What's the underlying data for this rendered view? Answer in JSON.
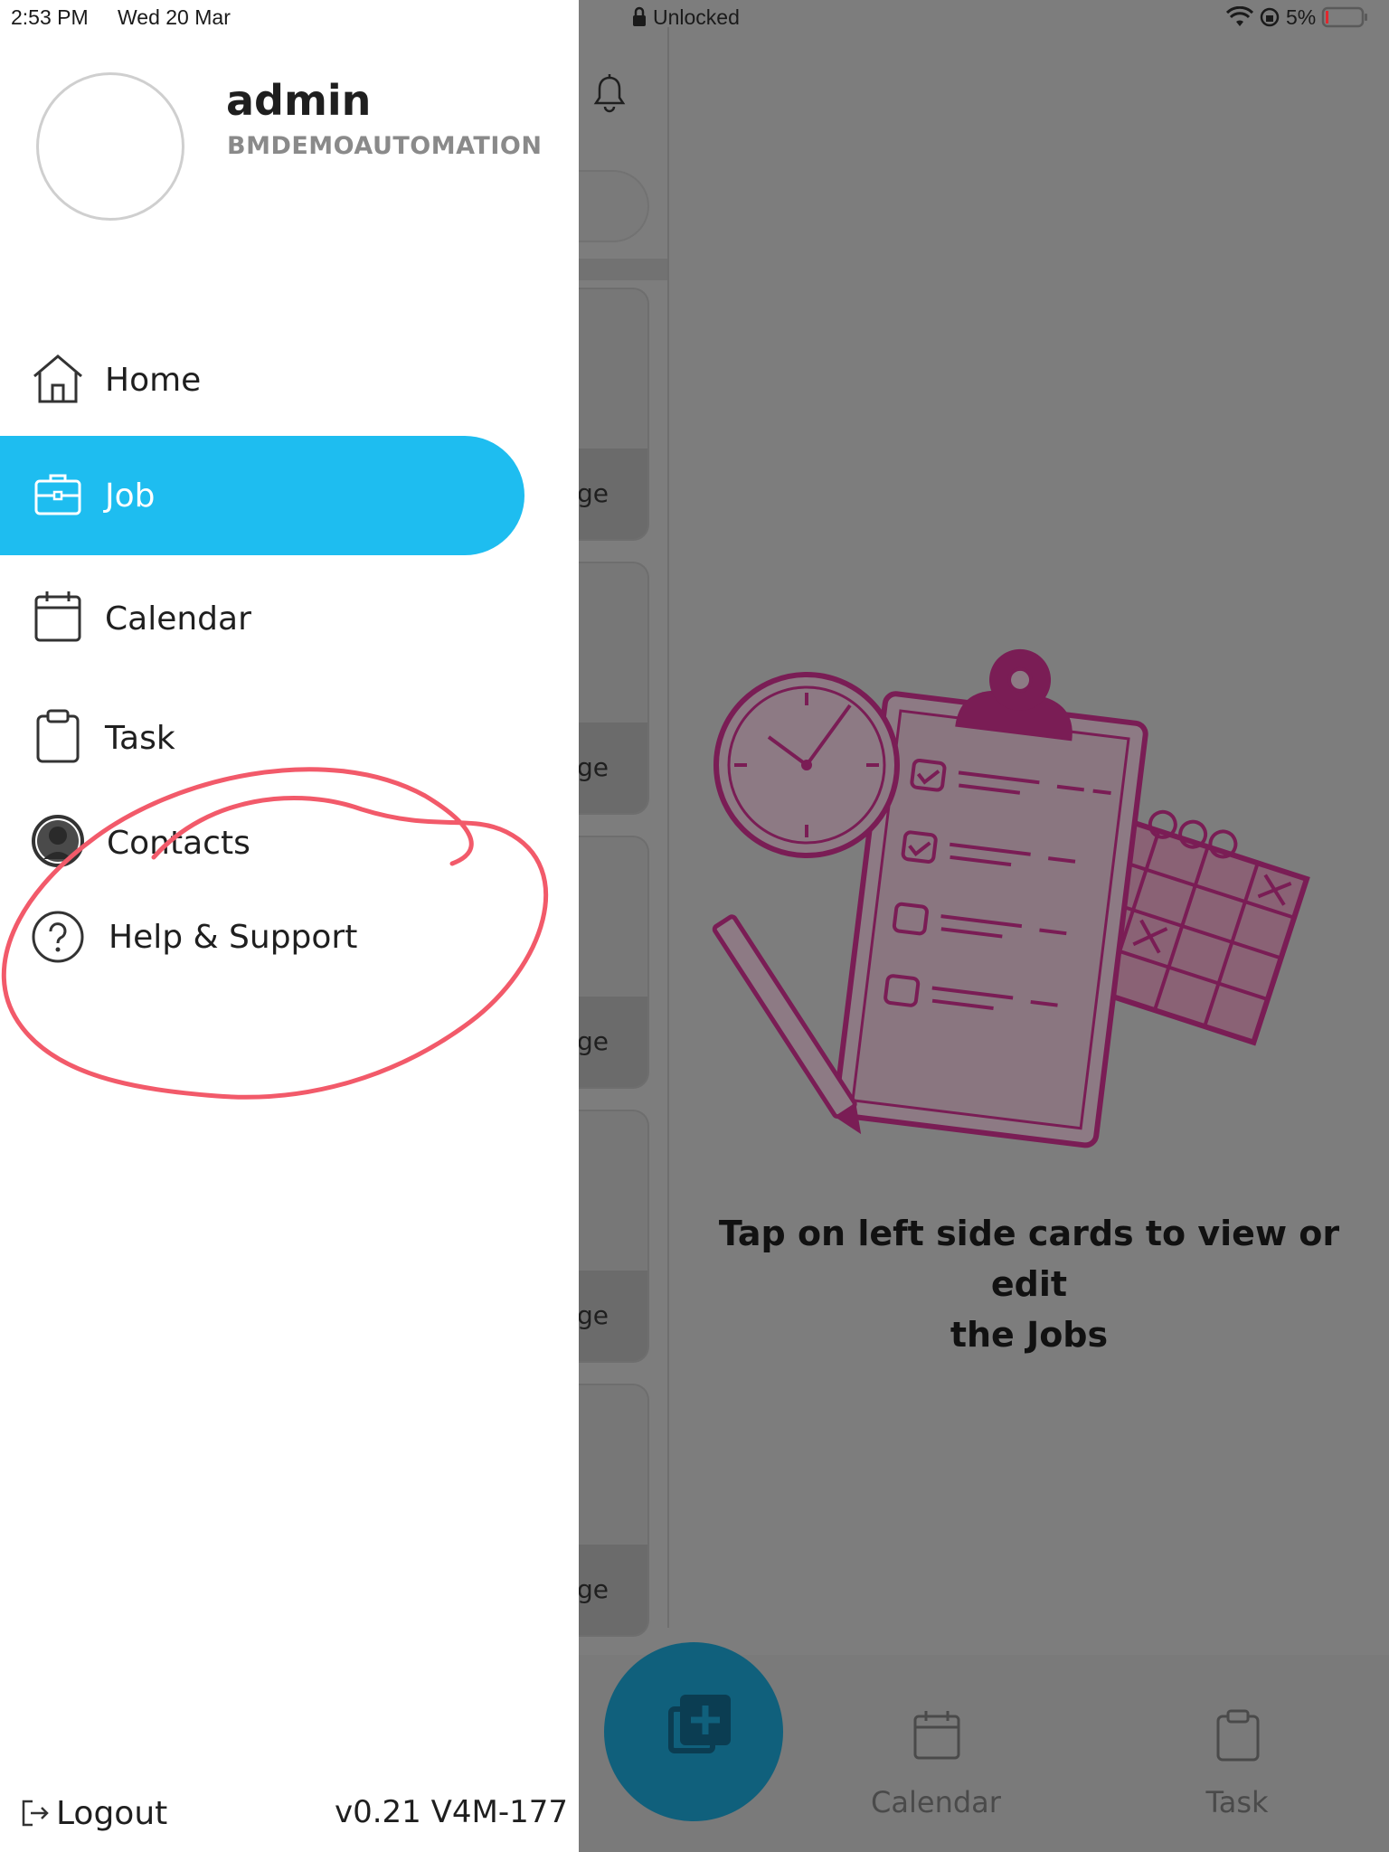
{
  "status_bar": {
    "time": "2:53 PM",
    "date": "Wed 20 Mar",
    "lock_text": "Unlocked",
    "battery": "5%"
  },
  "drawer": {
    "username": "admin",
    "company": "BMDEMOAUTOMATION",
    "items": [
      {
        "label": "Home",
        "icon": "home-icon",
        "active": false
      },
      {
        "label": "Job",
        "icon": "briefcase-icon",
        "active": true
      },
      {
        "label": "Calendar",
        "icon": "calendar-icon",
        "active": false
      },
      {
        "label": "Task",
        "icon": "clipboard-icon",
        "active": false
      },
      {
        "label": "Contacts",
        "icon": "person-icon",
        "active": false
      },
      {
        "label": "Help & Support",
        "icon": "question-icon",
        "active": false
      }
    ],
    "logout_label": "Logout",
    "version": "v0.21 V4M-177"
  },
  "main": {
    "card_fragment": "ge",
    "empty_message_line1": "Tap on left side cards to view or edit",
    "empty_message_line2": "the Jobs"
  },
  "bottom_bar": {
    "calendar_label": "Calendar",
    "task_label": "Task"
  },
  "colors": {
    "accent": "#1ebdf0",
    "fab": "#10607c",
    "annotation": "#f25a6a",
    "illustration": "#7a1d55"
  }
}
